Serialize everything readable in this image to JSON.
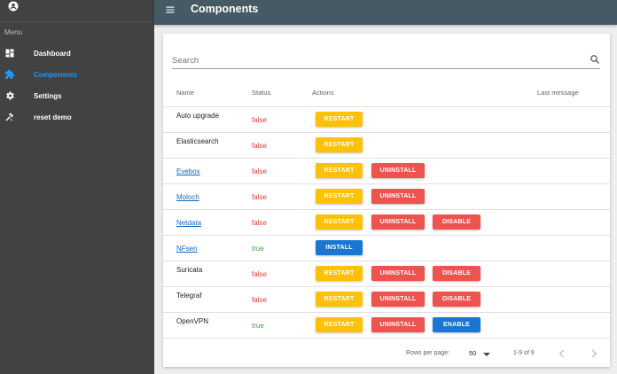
{
  "sidebar": {
    "menu_heading": "Menu",
    "items": [
      {
        "label": "Dashboard",
        "icon": "dashboard-icon"
      },
      {
        "label": "Components",
        "icon": "puzzle-icon",
        "active": true
      },
      {
        "label": "Settings",
        "icon": "gear-icon"
      },
      {
        "label": "reset demo",
        "icon": "hammer-icon"
      }
    ]
  },
  "appbar": {
    "title": "Components"
  },
  "search": {
    "placeholder": "Search",
    "value": ""
  },
  "table": {
    "columns": [
      "Name",
      "Status",
      "Actions",
      "Last message"
    ],
    "rows": [
      {
        "name": "Auto upgrade",
        "link": false,
        "status": "false",
        "actions": [
          "RESTART"
        ]
      },
      {
        "name": "Elasticsearch",
        "link": false,
        "status": "false",
        "actions": [
          "RESTART"
        ]
      },
      {
        "name": "Evebox",
        "link": true,
        "status": "false",
        "actions": [
          "RESTART",
          "UNINSTALL"
        ]
      },
      {
        "name": "Moloch",
        "link": true,
        "status": "false",
        "actions": [
          "RESTART",
          "UNINSTALL"
        ]
      },
      {
        "name": "Netdata",
        "link": true,
        "status": "false",
        "actions": [
          "RESTART",
          "UNINSTALL",
          "DISABLE"
        ]
      },
      {
        "name": "NFsen",
        "link": true,
        "status": "true",
        "actions": [
          "INSTALL"
        ]
      },
      {
        "name": "Suricata",
        "link": false,
        "status": "false",
        "actions": [
          "RESTART",
          "UNINSTALL",
          "DISABLE"
        ]
      },
      {
        "name": "Telegraf",
        "link": false,
        "status": "false",
        "actions": [
          "RESTART",
          "UNINSTALL",
          "DISABLE"
        ]
      },
      {
        "name": "OpenVPN",
        "link": false,
        "status": "true",
        "actions": [
          "RESTART",
          "UNINSTALL",
          "ENABLE"
        ]
      }
    ]
  },
  "footer": {
    "rows_per_page_label": "Rows per page:",
    "rows_per_page": "50",
    "range": "1-9 of 9"
  },
  "colors": {
    "sidebar_bg": "#424242",
    "appbar_bg": "#455a64",
    "active_nav": "#2196f3",
    "restart": "#ffc107",
    "uninstall": "#ef5350",
    "disable": "#ef5350",
    "install": "#1976d2",
    "enable": "#1976d2",
    "status_false": "#e53935",
    "status_true": "#43a047"
  }
}
